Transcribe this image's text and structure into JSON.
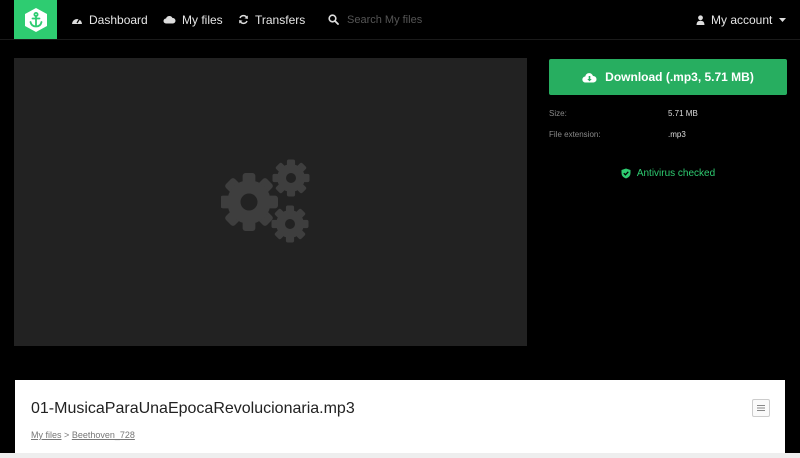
{
  "nav": {
    "items": [
      {
        "label": "Dashboard",
        "icon": "dashboard-icon"
      },
      {
        "label": "My files",
        "icon": "cloud-icon"
      },
      {
        "label": "Transfers",
        "icon": "refresh-icon"
      }
    ],
    "search_placeholder": "Search My files",
    "account_label": "My account"
  },
  "file": {
    "download_label": "Download (.mp3, 5.71 MB)",
    "size_label": "Size:",
    "size_value": "5.71 MB",
    "ext_label": "File extension:",
    "ext_value": ".mp3",
    "antivirus_label": "Antivirus checked",
    "name": "01-MusicaParaUnaEpocaRevolucionaria.mp3"
  },
  "breadcrumb": {
    "root": "My files",
    "separator": ">",
    "folder": "Beethoven_728"
  },
  "colors": {
    "accent": "#2ecc71",
    "download": "#27ae60",
    "preview_bg": "#222222"
  }
}
